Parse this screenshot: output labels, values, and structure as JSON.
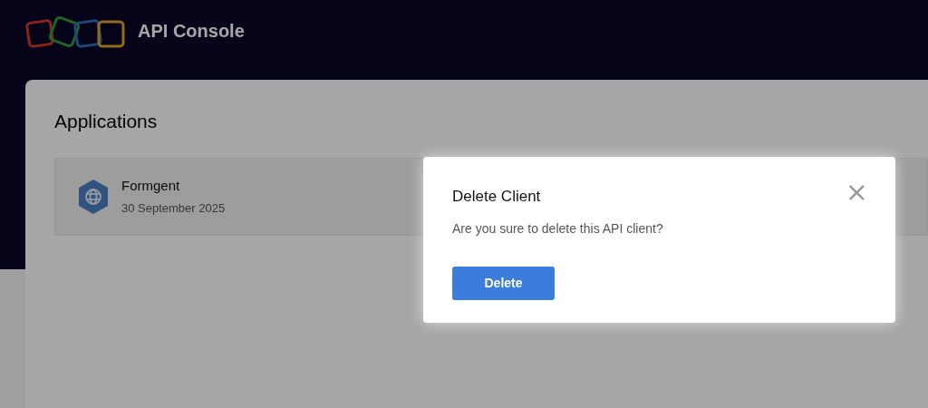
{
  "header": {
    "title": "API Console"
  },
  "page": {
    "heading": "Applications"
  },
  "applications": [
    {
      "name": "Formgent",
      "date": "30 September 2025"
    }
  ],
  "dialog": {
    "title": "Delete Client",
    "message": "Are you sure to delete this API client?",
    "close": "×",
    "button": "Delete"
  }
}
